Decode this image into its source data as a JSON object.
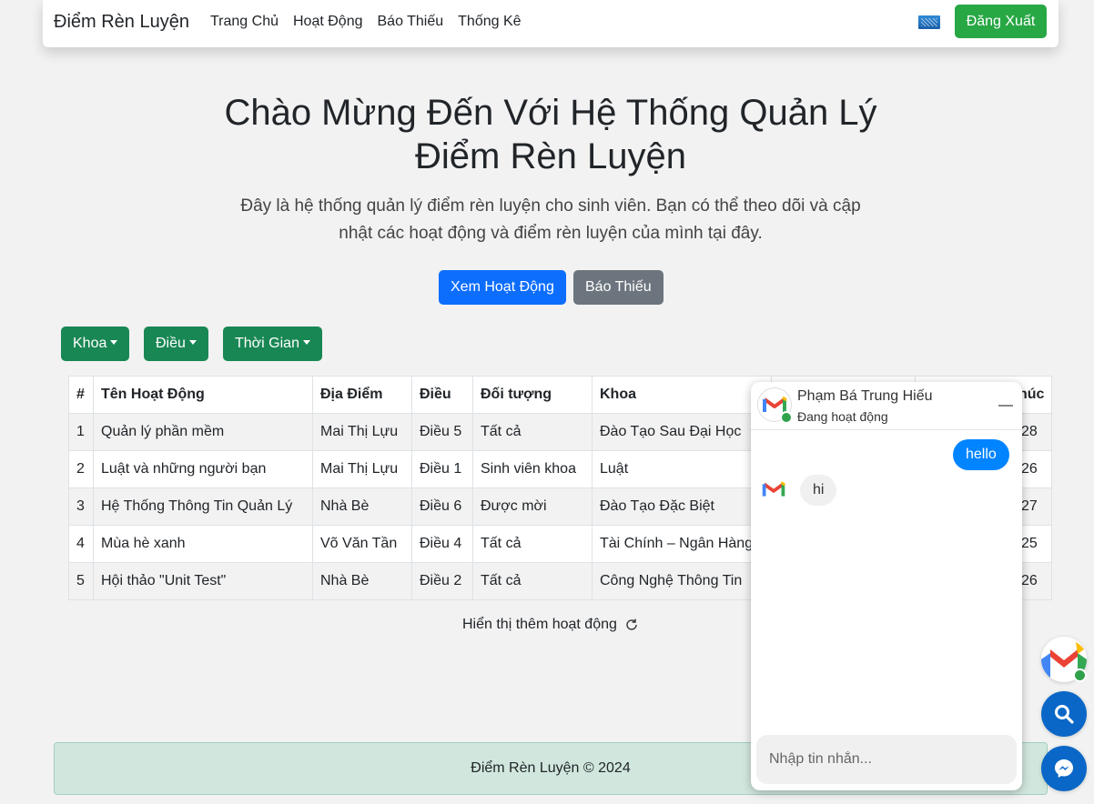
{
  "navbar": {
    "brand": "Điểm Rèn Luyện",
    "links": [
      "Trang Chủ",
      "Hoạt Động",
      "Báo Thiếu",
      "Thống Kê"
    ],
    "logout_label": "Đăng Xuất"
  },
  "hero": {
    "title": "Chào Mừng Đến Với Hệ Thống Quản Lý Điểm Rèn Luyện",
    "lead": "Đây là hệ thống quản lý điểm rèn luyện cho sinh viên. Bạn có thể theo dõi và cập nhật các hoạt động và điểm rèn luyện của mình tại đây.",
    "view_button": "Xem Hoạt Động",
    "report_button": "Báo Thiếu"
  },
  "filters": [
    "Khoa",
    "Điều",
    "Thời Gian"
  ],
  "table": {
    "headers": [
      "#",
      "Tên Hoạt Động",
      "Địa Điểm",
      "Điều",
      "Đối tượng",
      "Khoa",
      "",
      "húc"
    ],
    "rows": [
      [
        "1",
        "Quản lý phần mềm",
        "Mai Thị Lựu",
        "Điều 5",
        "Tất cả",
        "Đào Tạo Sau Đại Học",
        "",
        "28"
      ],
      [
        "2",
        "Luật và những người bạn",
        "Mai Thị Lựu",
        "Điều 1",
        "Sinh viên khoa",
        "Luật",
        "",
        "26"
      ],
      [
        "3",
        "Hệ Thống Thông Tin Quản Lý",
        "Nhà Bè",
        "Điều 6",
        "Được mời",
        "Đào Tạo Đặc Biệt",
        "",
        "27"
      ],
      [
        "4",
        "Mùa hè xanh",
        "Võ Văn Tần",
        "Điều 4",
        "Tất cả",
        "Tài Chính – Ngân Hàng",
        "",
        "25"
      ],
      [
        "5",
        "Hội thảo \"Unit Test\"",
        "Nhà Bè",
        "Điều 2",
        "Tất cả",
        "Công Nghệ Thông Tin",
        "",
        "26"
      ]
    ]
  },
  "load_more": "Hiển thị thêm hoạt động",
  "footer": "Điểm Rèn Luyện © 2024",
  "chat": {
    "contact_name": "Phạm Bá Trung Hiếu",
    "status": "Đang hoạt động",
    "messages": [
      {
        "from": "me",
        "text": "hello"
      },
      {
        "from": "contact",
        "text": "hi"
      }
    ],
    "input_placeholder": "Nhập tin nhắn..."
  },
  "icons": {
    "flag": "flag-icon",
    "reload": "reload-icon",
    "gmail": "gmail-icon",
    "search": "search-icon",
    "messenger": "messenger-icon",
    "minimize": "minimize-icon"
  },
  "colors": {
    "primary": "#0d6efd",
    "secondary": "#6c757d",
    "success": "#28a745",
    "filter_green": "#198754",
    "messenger_blue": "#0084ff",
    "footer_bg": "#d1e7dd"
  }
}
